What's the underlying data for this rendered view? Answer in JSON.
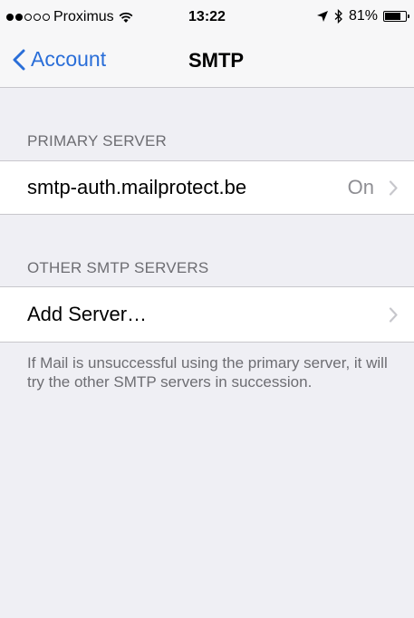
{
  "status_bar": {
    "carrier": "Proximus",
    "signal_bars_filled": 2,
    "signal_bars_total": 5,
    "time": "13:22",
    "battery_percent": "81%",
    "battery_level": 0.81
  },
  "nav": {
    "back_label": "Account",
    "title": "SMTP"
  },
  "primary_section": {
    "header": "PRIMARY SERVER",
    "server_name": "smtp-auth.mailprotect.be",
    "server_status": "On"
  },
  "other_section": {
    "header": "OTHER SMTP SERVERS",
    "add_label": "Add Server…"
  },
  "footer_note": "If Mail is unsuccessful using the primary server, it will try the other SMTP servers in succession.",
  "colors": {
    "accent": "#2a6ed8",
    "background": "#efeff4",
    "secondary_text": "#6d6d72"
  }
}
